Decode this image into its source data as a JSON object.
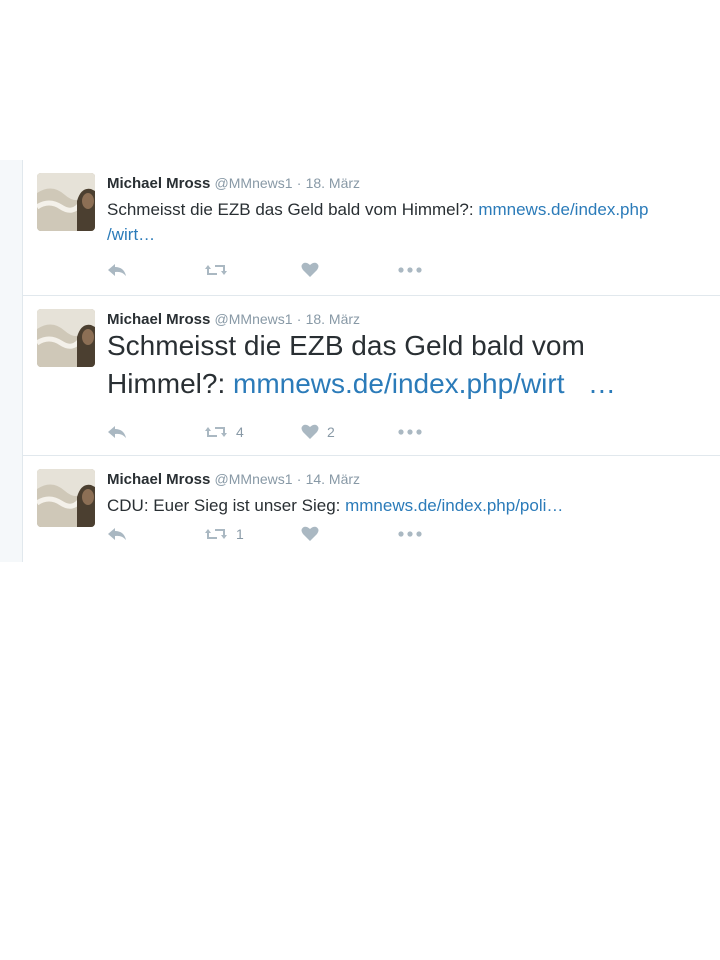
{
  "tweets": [
    {
      "name": "Michael Mross",
      "handle": "@MMnews1",
      "separator": "·",
      "date": "18. März",
      "text": "Schmeisst die EZB das Geld bald vom Himmel?: ",
      "link_line1": "mmnews.de/index.php",
      "link_line2": "/wirt…",
      "retweet_count": "",
      "like_count": ""
    },
    {
      "name": "Michael Mross",
      "handle": "@MMnews1",
      "separator": "·",
      "date": "18. März",
      "text": "Schmeisst die EZB das Geld bald vom Himmel?: ",
      "link": "mmnews.de/index.php/wirt",
      "link_ellipsis": "…",
      "retweet_count": "4",
      "like_count": "2"
    },
    {
      "name": "Michael Mross",
      "handle": "@MMnews1",
      "separator": "·",
      "date": "14. März",
      "text": "CDU: Euer Sieg ist unser Sieg: ",
      "link": "mmnews.de/index.php/poli…",
      "retweet_count": "1",
      "like_count": ""
    }
  ],
  "icons": {
    "reply": "reply-icon",
    "retweet": "retweet-icon",
    "like": "heart-icon",
    "more": "more-icon"
  },
  "colors": {
    "name": "#292f33",
    "meta": "#8899a6",
    "link": "#2b7bb9",
    "icon": "#aab8c2",
    "divider": "#e1e8ed"
  }
}
